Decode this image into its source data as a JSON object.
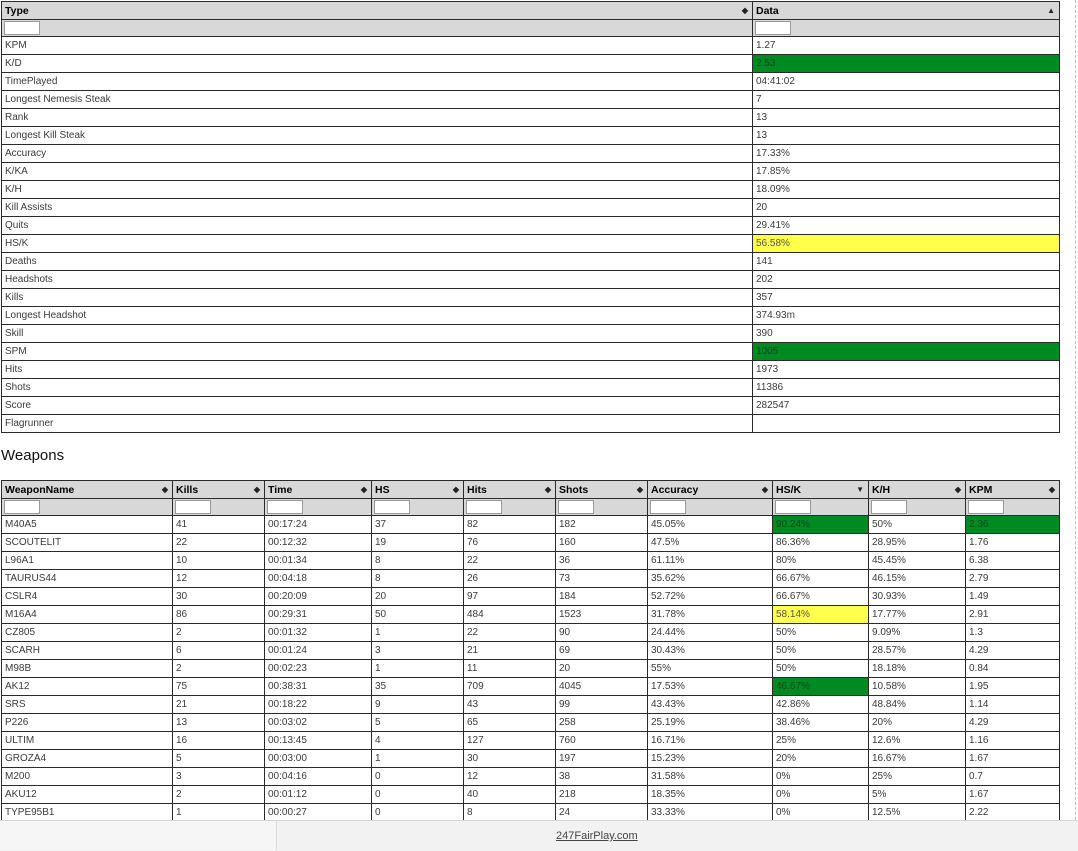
{
  "stats_table": {
    "headers": {
      "type": "Type",
      "data": "Data"
    },
    "rows": [
      {
        "label": "KPM",
        "value": "1.27",
        "highlight": ""
      },
      {
        "label": "K/D",
        "value": "2.53",
        "highlight": "green"
      },
      {
        "label": "TimePlayed",
        "value": "04:41:02",
        "highlight": ""
      },
      {
        "label": "Longest Nemesis Steak",
        "value": "7",
        "highlight": ""
      },
      {
        "label": "Rank",
        "value": "13",
        "highlight": ""
      },
      {
        "label": "Longest Kill Steak",
        "value": "13",
        "highlight": ""
      },
      {
        "label": "Accuracy",
        "value": "17.33%",
        "highlight": ""
      },
      {
        "label": "K/KA",
        "value": "17.85%",
        "highlight": ""
      },
      {
        "label": "K/H",
        "value": "18.09%",
        "highlight": ""
      },
      {
        "label": "Kill Assists",
        "value": "20",
        "highlight": ""
      },
      {
        "label": "Quits",
        "value": "29.41%",
        "highlight": ""
      },
      {
        "label": "HS/K",
        "value": "56.58%",
        "highlight": "yellow"
      },
      {
        "label": "Deaths",
        "value": "141",
        "highlight": ""
      },
      {
        "label": "Headshots",
        "value": "202",
        "highlight": ""
      },
      {
        "label": "Kills",
        "value": "357",
        "highlight": ""
      },
      {
        "label": "Longest Headshot",
        "value": "374.93m",
        "highlight": ""
      },
      {
        "label": "Skill",
        "value": "390",
        "highlight": ""
      },
      {
        "label": "SPM",
        "value": "1005",
        "highlight": "green"
      },
      {
        "label": "Hits",
        "value": "1973",
        "highlight": ""
      },
      {
        "label": "Shots",
        "value": "11386",
        "highlight": ""
      },
      {
        "label": "Score",
        "value": "282547",
        "highlight": ""
      },
      {
        "label": "Flagrunner",
        "value": "",
        "highlight": ""
      }
    ]
  },
  "weapons_section": {
    "title": "Weapons",
    "headers": [
      "WeaponName",
      "Kills",
      "Time",
      "HS",
      "Hits",
      "Shots",
      "Accuracy",
      "HS/K",
      "K/H",
      "KPM"
    ],
    "rows": [
      [
        "M40A5",
        "41",
        "00:17:24",
        "37",
        "82",
        "182",
        "45.05%",
        "90.24%",
        "50%",
        "2.36"
      ],
      [
        "SCOUTELIT",
        "22",
        "00:12:32",
        "19",
        "76",
        "160",
        "47.5%",
        "86.36%",
        "28.95%",
        "1.76"
      ],
      [
        "L96A1",
        "10",
        "00:01:34",
        "8",
        "22",
        "36",
        "61.11%",
        "80%",
        "45.45%",
        "6.38"
      ],
      [
        "TAURUS44",
        "12",
        "00:04:18",
        "8",
        "26",
        "73",
        "35.62%",
        "66.67%",
        "46.15%",
        "2.79"
      ],
      [
        "CSLR4",
        "30",
        "00:20:09",
        "20",
        "97",
        "184",
        "52.72%",
        "66.67%",
        "30.93%",
        "1.49"
      ],
      [
        "M16A4",
        "86",
        "00:29:31",
        "50",
        "484",
        "1523",
        "31.78%",
        "58.14%",
        "17.77%",
        "2.91"
      ],
      [
        "CZ805",
        "2",
        "00:01:32",
        "1",
        "22",
        "90",
        "24.44%",
        "50%",
        "9.09%",
        "1.3"
      ],
      [
        "SCARH",
        "6",
        "00:01:24",
        "3",
        "21",
        "69",
        "30.43%",
        "50%",
        "28.57%",
        "4.29"
      ],
      [
        "M98B",
        "2",
        "00:02:23",
        "1",
        "11",
        "20",
        "55%",
        "50%",
        "18.18%",
        "0.84"
      ],
      [
        "AK12",
        "75",
        "00:38:31",
        "35",
        "709",
        "4045",
        "17.53%",
        "46.67%",
        "10.58%",
        "1.95"
      ],
      [
        "SRS",
        "21",
        "00:18:22",
        "9",
        "43",
        "99",
        "43.43%",
        "42.86%",
        "48.84%",
        "1.14"
      ],
      [
        "P226",
        "13",
        "00:03:02",
        "5",
        "65",
        "258",
        "25.19%",
        "38.46%",
        "20%",
        "4.29"
      ],
      [
        "ULTIM",
        "16",
        "00:13:45",
        "4",
        "127",
        "760",
        "16.71%",
        "25%",
        "12.6%",
        "1.16"
      ],
      [
        "GROZA4",
        "5",
        "00:03:00",
        "1",
        "30",
        "197",
        "15.23%",
        "20%",
        "16.67%",
        "1.67"
      ],
      [
        "M200",
        "3",
        "00:04:16",
        "0",
        "12",
        "38",
        "31.58%",
        "0%",
        "25%",
        "0.7"
      ],
      [
        "AKU12",
        "2",
        "00:01:12",
        "0",
        "40",
        "218",
        "18.35%",
        "0%",
        "5%",
        "1.67"
      ],
      [
        "TYPE95B1",
        "1",
        "00:00:27",
        "0",
        "8",
        "24",
        "33.33%",
        "0%",
        "12.5%",
        "2.22"
      ]
    ],
    "highlights": [
      {
        "row": 0,
        "col": 7,
        "color": "green"
      },
      {
        "row": 0,
        "col": 9,
        "color": "green"
      },
      {
        "row": 5,
        "col": 7,
        "color": "yellow"
      },
      {
        "row": 9,
        "col": 7,
        "color": "green"
      }
    ]
  },
  "footer": {
    "link_text": "247FairPlay.com"
  },
  "colors": {
    "green": "#008a22",
    "yellow": "#ffff4c",
    "header_bg": "#d8d8d8"
  },
  "icons": {
    "sortable": "sort-both-icon",
    "sorted_asc": "sort-asc-icon",
    "sorted_desc": "sort-desc-icon"
  }
}
